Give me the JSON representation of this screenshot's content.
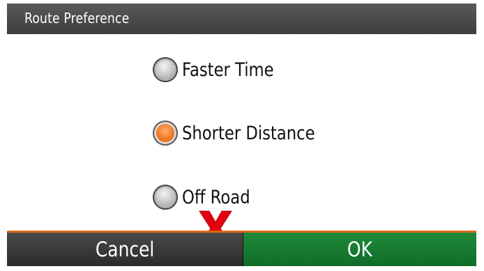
{
  "dialog": {
    "title": "Route Preference"
  },
  "options": [
    {
      "label": "Faster Time",
      "selected": false
    },
    {
      "label": "Shorter Distance",
      "selected": true
    },
    {
      "label": "Off Road",
      "selected": false
    }
  ],
  "buttons": {
    "cancel_label": "Cancel",
    "ok_label": "OK"
  },
  "colors": {
    "accent_selected": "#f27a25",
    "ok_green": "#138333",
    "x_mark": "#e3000f"
  },
  "icons": {
    "overlay_mark": "red-x-mark-icon"
  }
}
